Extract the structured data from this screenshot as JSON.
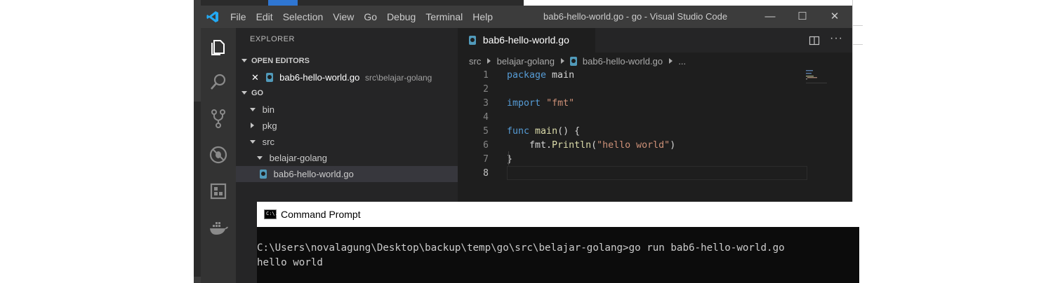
{
  "vscode": {
    "menu": [
      "File",
      "Edit",
      "Selection",
      "View",
      "Go",
      "Debug",
      "Terminal",
      "Help"
    ],
    "window_title": "bab6-hello-world.go - go - Visual Studio Code",
    "controls": {
      "minimize": "—",
      "maximize": "☐",
      "close": "✕"
    }
  },
  "explorer": {
    "title": "EXPLORER",
    "open_editors_label": "OPEN EDITORS",
    "open_editor_file": "bab6-hello-world.go",
    "open_editor_path": "src\\belajar-golang",
    "workspace_label": "GO",
    "tree": [
      {
        "label": "bin",
        "expanded": true
      },
      {
        "label": "pkg",
        "expanded": false
      },
      {
        "label": "src",
        "expanded": true
      },
      {
        "label": "belajar-golang",
        "expanded": true
      },
      {
        "label": "bab6-hello-world.go",
        "selected": true
      }
    ]
  },
  "editor": {
    "tab_label": "bab6-hello-world.go",
    "breadcrumb": {
      "part1": "src",
      "part2": "belajar-golang",
      "part3": "bab6-hello-world.go",
      "more": "..."
    },
    "lines": [
      "1",
      "2",
      "3",
      "4",
      "5",
      "6",
      "7",
      "8"
    ],
    "code": {
      "l1_kw": "package",
      "l1_rest": " main",
      "l3_kw": "import",
      "l3_str": "\"fmt\"",
      "l5_kw": "func",
      "l5_fn": "main",
      "l5_rest": "() {",
      "l6_pre": "    fmt.",
      "l6_fn": "Println",
      "l6_open": "(",
      "l6_str": "\"hello world\"",
      "l6_close": ")",
      "l7": "}"
    }
  },
  "cmd": {
    "title": "Command Prompt",
    "icon_text": "C:\\.",
    "line1": "C:\\Users\\novalagung\\Desktop\\backup\\temp\\go\\src\\belajar-golang>go run bab6-hello-world.go",
    "line2": "hello world"
  },
  "colors": {
    "accent": "#007acc",
    "keyword": "#569cd6",
    "string": "#ce9178",
    "function": "#dcdcaa",
    "go_icon": "#519aba"
  }
}
